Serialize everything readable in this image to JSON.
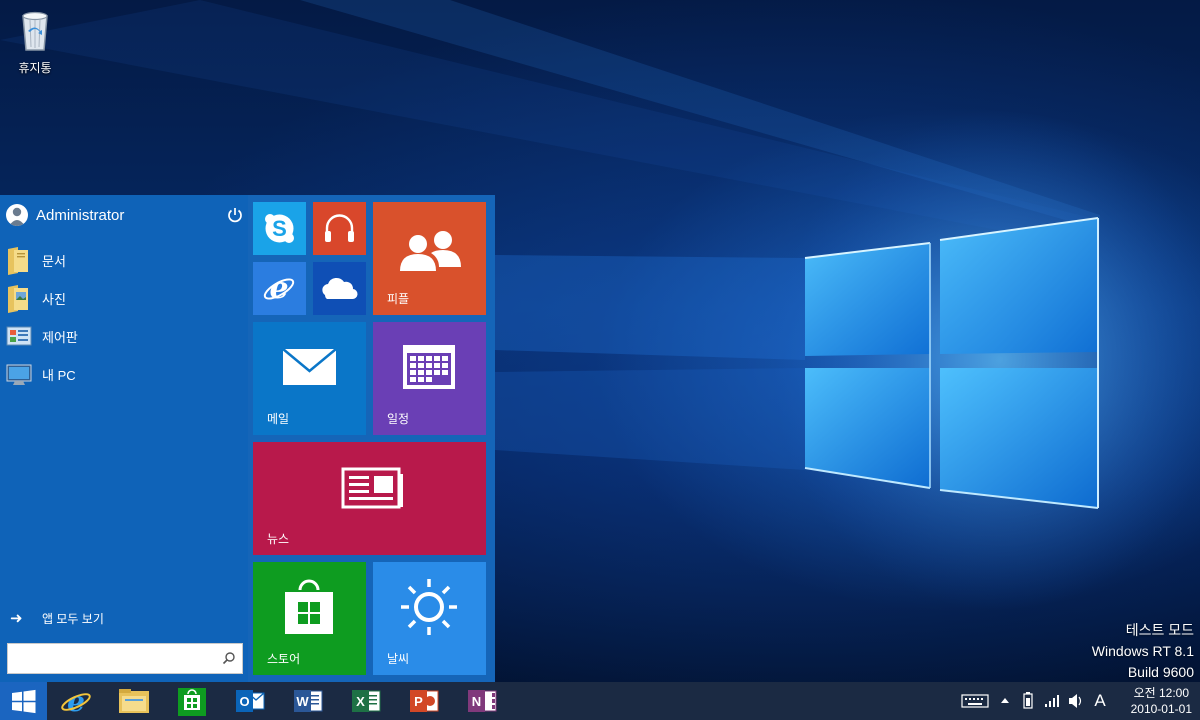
{
  "desktop": {
    "recycle_bin_label": "휴지통",
    "watermark": {
      "line1": "테스트 모드",
      "line2": "Windows RT 8.1",
      "line3": "Build 9600"
    }
  },
  "start_menu": {
    "user_name": "Administrator",
    "places": [
      {
        "label": "문서",
        "icon": "documents-folder-icon"
      },
      {
        "label": "사진",
        "icon": "pictures-folder-icon"
      },
      {
        "label": "제어판",
        "icon": "control-panel-icon"
      },
      {
        "label": "내 PC",
        "icon": "this-pc-icon"
      }
    ],
    "all_apps_label": "앱 모두 보기",
    "search_placeholder": "",
    "tiles": {
      "people": "피플",
      "mail": "메일",
      "calendar": "일정",
      "news": "뉴스",
      "store": "스토어",
      "weather": "날씨"
    },
    "colors": {
      "skype": "#1aa3e8",
      "music": "#d9472b",
      "ie": "#2b7de0",
      "onedrive": "#0f4fb5",
      "people": "#d9512c",
      "mail": "#0a76c8",
      "calendar": "#6a3fb5",
      "news": "#b8194b",
      "store": "#0e9c20",
      "weather": "#2a8ce8"
    }
  },
  "taskbar": {
    "apps": [
      "start-icon",
      "internet-explorer-icon",
      "file-explorer-icon",
      "store-icon",
      "outlook-icon",
      "word-icon",
      "excel-icon",
      "powerpoint-icon",
      "onenote-icon"
    ],
    "ime_label": "A",
    "clock_time": "오전 12:00",
    "clock_date": "2010-01-01"
  }
}
